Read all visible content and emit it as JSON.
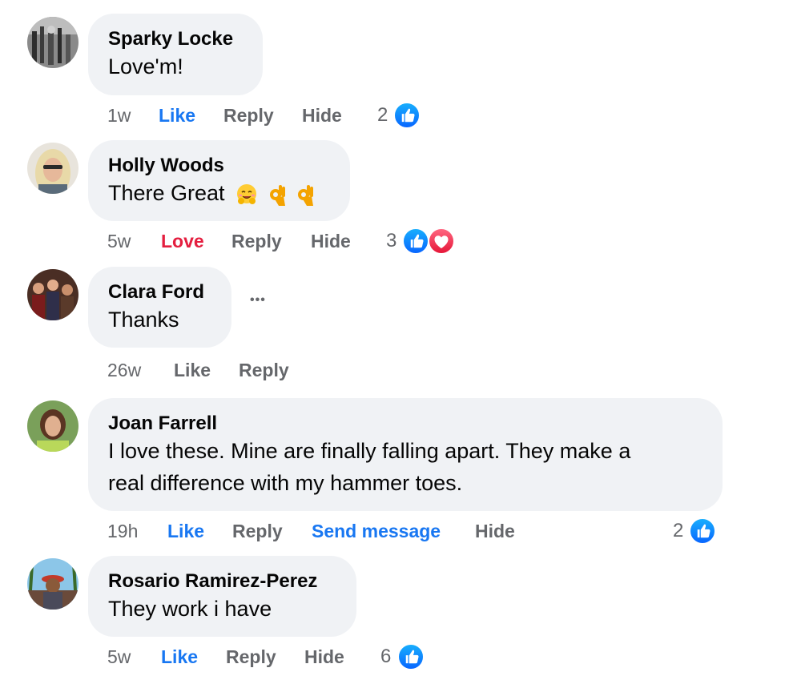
{
  "comments": [
    {
      "author": "Sparky Locke",
      "text": "Love'm!",
      "time": "1w",
      "reaction_label": "Like",
      "reply_label": "Reply",
      "hide_label": "Hide",
      "reaction_count": "2",
      "reactions": [
        "like"
      ]
    },
    {
      "author": "Holly Woods",
      "text": "There Great",
      "emojis": [
        "hugging-face",
        "ok-hand",
        "ok-hand"
      ],
      "time": "5w",
      "reaction_label": "Love",
      "reply_label": "Reply",
      "hide_label": "Hide",
      "reaction_count": "3",
      "reactions": [
        "like",
        "love"
      ]
    },
    {
      "author": "Clara Ford",
      "text": "Thanks",
      "time": "26w",
      "reaction_label": "Like",
      "reply_label": "Reply",
      "more_label": "•••"
    },
    {
      "author": "Joan Farrell",
      "text_line1": "I love these. Mine are finally falling apart. They make a",
      "text_line2": "real difference with my hammer toes.",
      "time": "19h",
      "reaction_label": "Like",
      "reply_label": "Reply",
      "send_message_label": "Send message",
      "hide_label": "Hide",
      "reaction_count": "2",
      "reactions": [
        "like"
      ]
    },
    {
      "author": "Rosario Ramirez-Perez",
      "text": "They work i have",
      "time": "5w",
      "reaction_label": "Like",
      "reply_label": "Reply",
      "hide_label": "Hide",
      "reaction_count": "6",
      "reactions": [
        "like"
      ]
    }
  ],
  "colors": {
    "bubble": "#f0f2f5",
    "secondary_text": "#65676b",
    "like_blue": "#1877f2",
    "love_red": "#e41e3f"
  }
}
